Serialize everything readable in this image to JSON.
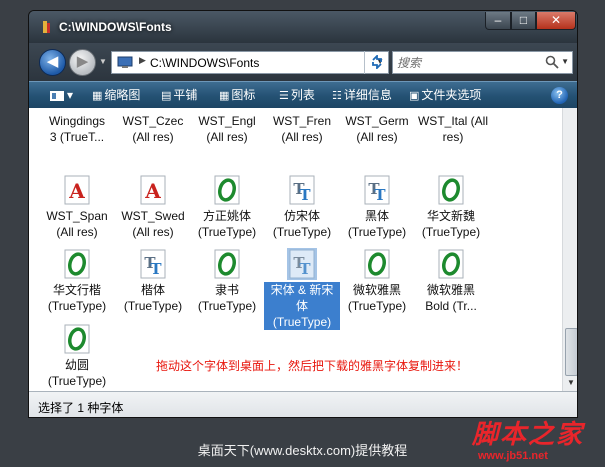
{
  "window": {
    "title": "C:\\WINDOWS\\Fonts",
    "minimize": "–",
    "maximize": "□",
    "close": "✕"
  },
  "address": {
    "path": "C:\\WINDOWS\\Fonts",
    "back": "◀",
    "forward": "▶"
  },
  "search": {
    "placeholder": "搜索"
  },
  "toolbar": {
    "organize_label": "▾",
    "items": [
      "缩略图",
      "平铺",
      "图标",
      "列表",
      "详细信息",
      "文件夹选项"
    ],
    "help": "?"
  },
  "fonts": [
    {
      "line1": "Wingdings",
      "line2": "3 (TrueT...",
      "icon": "opentype-icon"
    },
    {
      "line1": "WST_Czec",
      "line2": "(All res)",
      "icon": "none"
    },
    {
      "line1": "WST_Engl",
      "line2": "(All res)",
      "icon": "none"
    },
    {
      "line1": "WST_Fren",
      "line2": "(All res)",
      "icon": "none"
    },
    {
      "line1": "WST_Germ",
      "line2": "(All res)",
      "icon": "none"
    },
    {
      "line1": "WST_Ital (All",
      "line2": "res)",
      "icon": "none"
    },
    {
      "line1": "WST_Span",
      "line2": "(All res)",
      "icon": "raster-font-icon"
    },
    {
      "line1": "WST_Swed",
      "line2": "(All res)",
      "icon": "raster-font-icon"
    },
    {
      "line1": "方正姚体",
      "line2": "(TrueType)",
      "icon": "opentype-icon"
    },
    {
      "line1": "仿宋体",
      "line2": "(TrueType)",
      "icon": "truetype-icon"
    },
    {
      "line1": "黑体",
      "line2": "(TrueType)",
      "icon": "truetype-icon"
    },
    {
      "line1": "华文新魏",
      "line2": "(TrueType)",
      "icon": "opentype-icon"
    },
    {
      "line1": "华文行楷",
      "line2": "(TrueType)",
      "icon": "opentype-icon"
    },
    {
      "line1": "楷体",
      "line2": "(TrueType)",
      "icon": "truetype-icon"
    },
    {
      "line1": "隶书",
      "line2": "(TrueType)",
      "icon": "opentype-icon"
    },
    {
      "line1": "宋体 & 新宋",
      "line2": "体",
      "line3": "(TrueType)",
      "icon": "truetype-icon",
      "selected": true
    },
    {
      "line1": "微软雅黑",
      "line2": "(TrueType)",
      "icon": "opentype-icon"
    },
    {
      "line1": "微软雅黑",
      "line2": "Bold (Tr...",
      "icon": "opentype-icon"
    },
    {
      "line1": "幼圆",
      "line2": "(TrueType)",
      "icon": "opentype-icon"
    }
  ],
  "annotation": "拖动这个字体到桌面上，然后把下载的雅黑字体复制进来！",
  "status": "选择了 1 种字体",
  "caption": "桌面天下(www.desktx.com)提供教程",
  "watermark": {
    "main": "脚本之家",
    "url": "www.jb51.net"
  },
  "colors": {
    "toolbar": "#245173",
    "selection": "#3c7fce",
    "annotation": "#e8170e",
    "watermark": "#e9252b"
  }
}
